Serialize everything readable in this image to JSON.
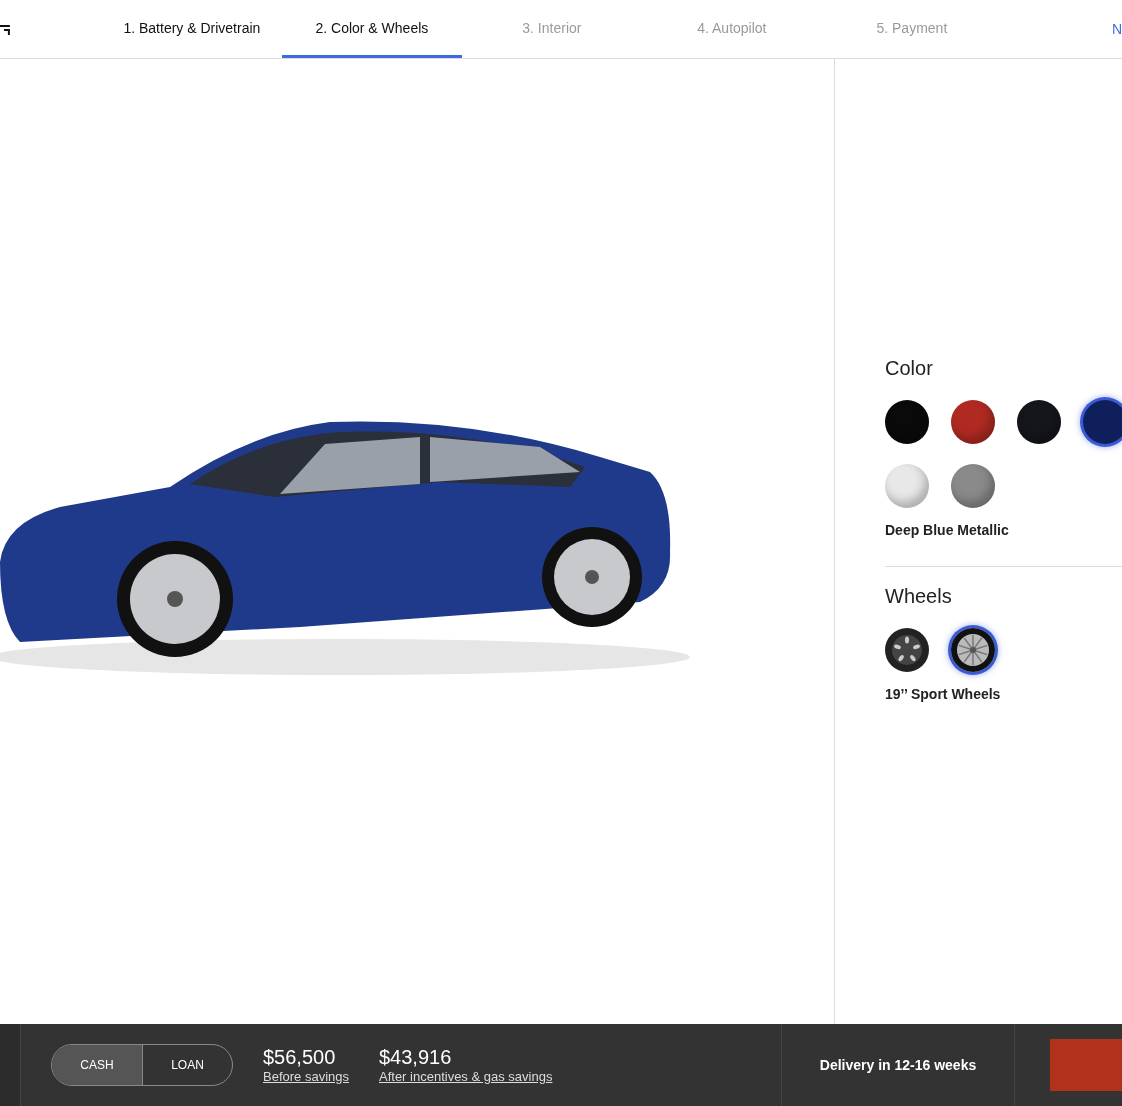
{
  "nav": {
    "tabs": [
      {
        "label": "1. Battery & Drivetrain",
        "selected": false,
        "disabled": false
      },
      {
        "label": "2. Color & Wheels",
        "selected": true,
        "disabled": false
      },
      {
        "label": "3. Interior",
        "selected": false,
        "disabled": true
      },
      {
        "label": "4. Autopilot",
        "selected": false,
        "disabled": true
      },
      {
        "label": "5. Payment",
        "selected": false,
        "disabled": true
      }
    ],
    "next_link": "N"
  },
  "options": {
    "color": {
      "heading": "Color",
      "swatches": [
        {
          "color": "#0a0a0a",
          "selected": false
        },
        {
          "color": "#b02a22",
          "selected": false
        },
        {
          "color": "#15161c",
          "selected": false
        },
        {
          "color": "#0e1f5c",
          "selected": true
        },
        {
          "color": "#e8e8e8",
          "selected": false
        },
        {
          "color": "#8a8a8a",
          "selected": false
        }
      ],
      "chosen": "Deep Blue Metallic"
    },
    "wheels": {
      "heading": "Wheels",
      "items": [
        {
          "kind": "aero",
          "selected": false
        },
        {
          "kind": "sport",
          "selected": true
        }
      ],
      "chosen": "19’’ Sport Wheels"
    }
  },
  "footer": {
    "payment_modes": [
      {
        "label": "CASH",
        "selected": true
      },
      {
        "label": "LOAN",
        "selected": false
      }
    ],
    "prices": [
      {
        "amount": "$56,500",
        "note": "Before savings"
      },
      {
        "amount": "$43,916",
        "note": "After incentives & gas savings"
      }
    ],
    "delivery": "Delivery in 12-16 weeks"
  }
}
